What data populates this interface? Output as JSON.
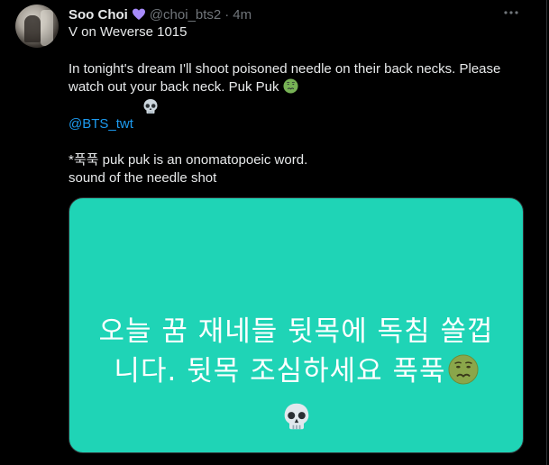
{
  "tweet": {
    "display_name": "Soo Choi",
    "handle": "@choi_bts2",
    "separator": "·",
    "time": "4m",
    "more_label": "···",
    "line1": "V on Weverse 1015",
    "paragraph": "In tonight's dream I'll shoot poisoned needle on their back necks. Please watch out your back neck. Puk Puk",
    "paragraph_emoji": "nauseated-face-emoji",
    "skull_line": "💀",
    "mention": "@BTS_twt",
    "note_line1": "*푹푹 puk puk is an onomatopoeic word.",
    "note_line2": "sound of the needle shot",
    "heart_color": "#a78bfa"
  },
  "media": {
    "background_color": "#1fd4b6",
    "text_line1": "오늘 꿈 재네들 뒷목에 독침 쏠껍",
    "text_line2": "니다. 뒷목 조심하세요 푹푹",
    "line2_emoji": "nauseated-face-emoji",
    "line3_emoji": "skull-emoji"
  }
}
